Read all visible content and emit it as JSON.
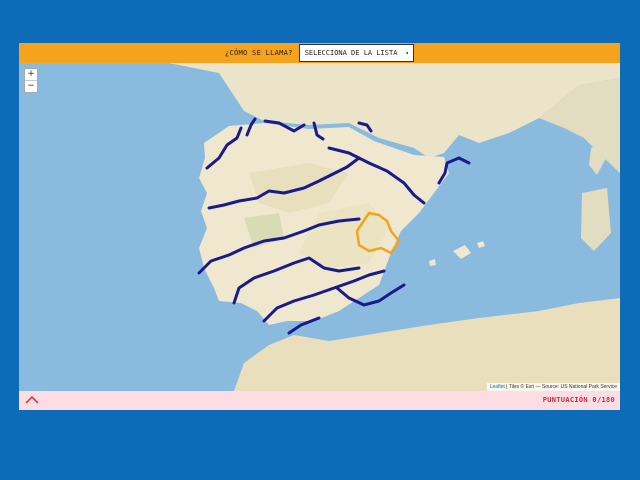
{
  "header": {
    "question": "¿CÓMO SE LLAMA?",
    "select_value": "SELECCIONA DE LA LISTA",
    "select_arrow": "▾"
  },
  "map": {
    "zoom_in": "+",
    "zoom_out": "−",
    "attribution_link": "Leaflet",
    "attribution_text": " | Tiles © Esri — Source: US National Park Service"
  },
  "footer": {
    "score_label": "PUNTUACIÓN",
    "score_value": "0",
    "score_total": "/180"
  },
  "colors": {
    "header_bg": "#f5a21c",
    "footer_bg": "#fbdde3",
    "score_text": "#c62f3b",
    "river": "#1a1a8c",
    "highlight_river": "#f5a21c",
    "sea": "#8bbadf",
    "page_bg": "#0e6bb8"
  }
}
